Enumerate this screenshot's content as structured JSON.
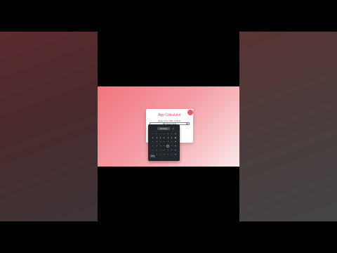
{
  "app": {
    "title": "Age Calculator",
    "close_label": "",
    "accent_color": "#e0525f"
  },
  "form": {
    "dob_label": "Enter Your Date of Birth",
    "dob_value": "dd / mm / yyyy"
  },
  "datepicker": {
    "month_label": "January",
    "today_label": "Today",
    "selected_index": 25,
    "day_count": 42,
    "icons": {
      "calendar": "calendar-icon",
      "up": "chevron-up-icon",
      "down": "chevron-down-icon"
    }
  }
}
